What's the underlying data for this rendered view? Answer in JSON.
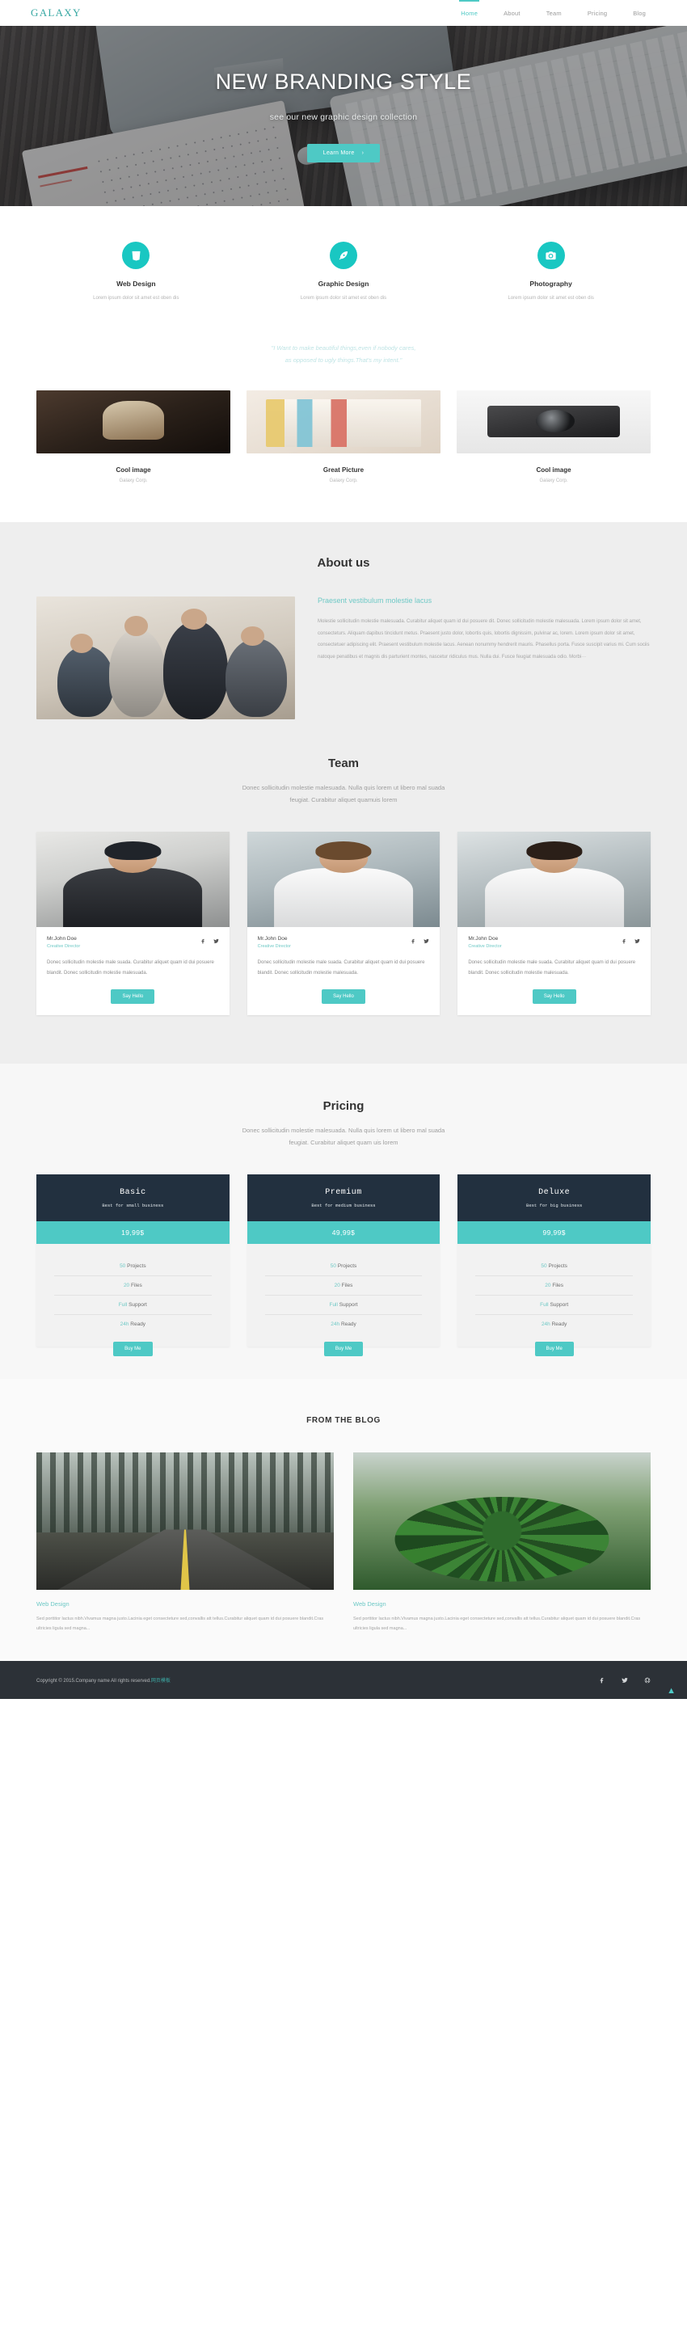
{
  "nav": {
    "brand": "GALAXY",
    "links": [
      {
        "label": "Home",
        "active": true
      },
      {
        "label": "About",
        "active": false
      },
      {
        "label": "Team",
        "active": false
      },
      {
        "label": "Pricing",
        "active": false
      },
      {
        "label": "Blog",
        "active": false
      }
    ]
  },
  "hero": {
    "title": "NEW BRANDING STYLE",
    "subtitle": "see our new graphic design collection",
    "cta_label": "Learn More",
    "cta_chevron": "›",
    "accent_color": "#4ec9c5"
  },
  "services": [
    {
      "icon": "css3-icon",
      "title": "Web Design",
      "desc": "Lorem ipsum dolor sit amet est oben dis"
    },
    {
      "icon": "pen-nib-icon",
      "title": "Graphic Design",
      "desc": "Lorem ipsum dolor sit amet est oben dis"
    },
    {
      "icon": "camera-icon",
      "title": "Photography",
      "desc": "Lorem ipsum dolor sit amet est oben dis"
    }
  ],
  "quote": {
    "line1": "\"I Want to make beautiful things,even if nobody cares,",
    "line2": "as opposed to ugly things.That's my intent.\""
  },
  "portfolio": [
    {
      "title": "Cool image",
      "company": "Galaxy Corp."
    },
    {
      "title": "Great Picture",
      "company": "Galaxy Corp."
    },
    {
      "title": "Cool image",
      "company": "Galaxy Corp."
    }
  ],
  "about": {
    "heading": "About us",
    "sub_heading": "Praesent vestibulum molestie lacus",
    "paragraph": "Molestie sollicitudin molestie malesuada. Curabitur aliquet quam id dui posuere dit. Donec sollicitudin molestie malesuada. Lorem ipsum dolor sit amet, consecteturs. Aliquam dapibus tincidunt metus. Praesent justo dolor, lobortis quis, lobortis dignissim, pulvinar ac, lorem. Lorem ipsum dolor sit amet, consectetuer adipiscing elit. Praesent vestibulum molestie lacus. Aenean nonummy hendrerit mauris. Phasellus porta. Fusce suscipit varius mi. Cum sociis natoque penatibus et magnis dis parturient montes, nascetur ridiculus mus. Nulla dui. Fusce feugiat malesuada odio. Morbi···"
  },
  "team": {
    "heading": "Team",
    "sub_line1": "Donec sollicitudin molestie malesuada. Nulla quis lorem ut libero mal suada",
    "sub_line2": "feugiat. Curabitur aliquet quamuis lorem",
    "members": [
      {
        "name": "Mr.John Doe",
        "role": "Creative Director",
        "desc": "Donec sollicitudin molestie male suada. Curabitur aliquet quam id dui posuere blandit. Donec sollicitudin molestie malesuada.",
        "button": "Say Hello"
      },
      {
        "name": "Mr.John Doe",
        "role": "Creative Director",
        "desc": "Donec sollicitudin molestie male suada. Curabitur aliquet quam id dui posuere blandit. Donec sollicitudin molestie malesuada.",
        "button": "Say Hello"
      },
      {
        "name": "Mr.John Doe",
        "role": "Creative Director",
        "desc": "Donec sollicitudin molestie male suada. Curabitur aliquet quam id dui posuere blandit. Donec sollicitudin molestie malesuada.",
        "button": "Say Hello"
      }
    ]
  },
  "pricing": {
    "heading": "Pricing",
    "sub_line1": "Donec sollicitudin molestie malesuada. Nulla quis lorem ut libero mal suada",
    "sub_line2": "feugiat. Curabitur aliquet quam uis lorem",
    "plans": [
      {
        "name": "Basic",
        "tagline": "Best for small business",
        "price": "19,99$",
        "features": [
          {
            "value": "50",
            "label": "Projects"
          },
          {
            "value": "20",
            "label": "Files"
          },
          {
            "value": "Full",
            "label": "Support"
          },
          {
            "value": "24h",
            "label": "Ready"
          }
        ],
        "button": "Buy Me"
      },
      {
        "name": "Premium",
        "tagline": "Best for medium business",
        "price": "49,99$",
        "features": [
          {
            "value": "50",
            "label": "Projects"
          },
          {
            "value": "20",
            "label": "Files"
          },
          {
            "value": "Full",
            "label": "Support"
          },
          {
            "value": "24h",
            "label": "Ready"
          }
        ],
        "button": "Buy Me"
      },
      {
        "name": "Deluxe",
        "tagline": "Best for big business",
        "price": "99,99$",
        "features": [
          {
            "value": "50",
            "label": "Projects"
          },
          {
            "value": "20",
            "label": "Files"
          },
          {
            "value": "Full",
            "label": "Support"
          },
          {
            "value": "24h",
            "label": "Ready"
          }
        ],
        "button": "Buy Me"
      }
    ]
  },
  "blog": {
    "heading": "FROM THE BLOG",
    "posts": [
      {
        "title": "Web Design",
        "excerpt": "Sed porttitor lactus nibh.Vivamus magna justo.Lacinia eget consecteture sed,convallis att tellus.Curabitur aliquet quam id dui posuere blandit.Cras ultricies ligula sed magna..."
      },
      {
        "title": "Web Design",
        "excerpt": "Sed porttitor lactus nibh.Vivamus magna justo.Lacinia eget consecteture sed,convallis att tellus.Curabitur aliquet quam id dui posuere blandit.Cras ultricies ligula sed magna..."
      }
    ]
  },
  "footer": {
    "copyright": "Copyright © 2015.Company name All rights reserved.",
    "credit": "网页模板",
    "social": [
      "facebook-icon",
      "twitter-icon",
      "globe-icon"
    ],
    "to_top": "▲"
  }
}
